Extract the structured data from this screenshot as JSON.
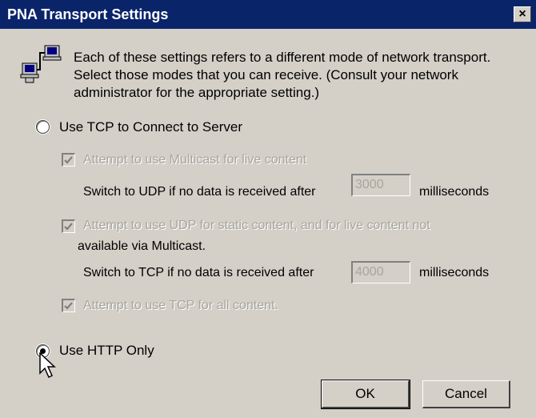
{
  "window": {
    "title": "PNA Transport Settings",
    "close_label": "×"
  },
  "intro": {
    "icon": "network-computers-icon",
    "text": "Each of these settings refers to a different mode of network transport. Select those modes that you can receive. (Consult your network administrator for the appropriate setting.)"
  },
  "tcp_option": {
    "label": "Use TCP to Connect to Server",
    "selected": false,
    "multicast": {
      "label": "Attempt to use Multicast for live content",
      "checked": true,
      "switch_prefix": "Switch to UDP if no data is received after",
      "value": "3000",
      "unit": "milliseconds"
    },
    "udp": {
      "label_line1": "Attempt to use UDP for static content, and for live content not",
      "label_line2": "available via Multicast.",
      "checked": true,
      "switch_prefix": "Switch to TCP if no data is received after",
      "value": "4000",
      "unit": "milliseconds"
    },
    "tcp_all": {
      "label": "Attempt to use TCP for all content.",
      "checked": true
    }
  },
  "http_option": {
    "label": "Use HTTP Only",
    "selected": true
  },
  "buttons": {
    "ok": "OK",
    "cancel": "Cancel"
  },
  "colors": {
    "titlebar": "#0a246a",
    "dialog": "#d4d0c8",
    "disabled_text": "#a8a59d"
  }
}
